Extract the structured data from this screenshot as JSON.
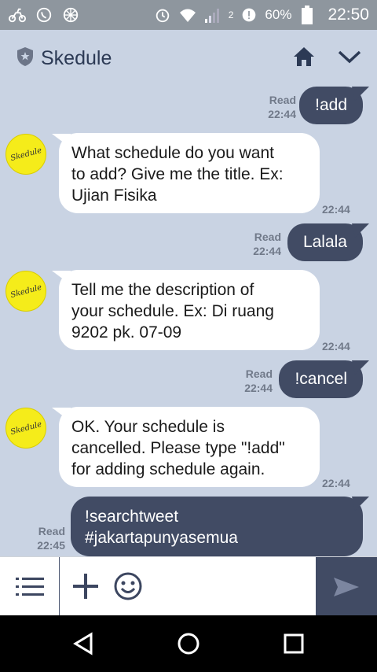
{
  "status_bar": {
    "battery": "60%",
    "time": "22:50",
    "network_label": "2"
  },
  "header": {
    "title": "Skedule"
  },
  "avatar_text": "Skedule",
  "messages": [
    {
      "dir": "out",
      "text": "!add",
      "read": "Read",
      "time": "22:44"
    },
    {
      "dir": "in",
      "lines": [
        "What schedule do you want",
        "to add? Give me the title. Ex:",
        "Ujian Fisika"
      ],
      "time": "22:44"
    },
    {
      "dir": "out",
      "text": "Lalala",
      "read": "Read",
      "time": "22:44"
    },
    {
      "dir": "in",
      "lines": [
        "Tell me the description of",
        "your schedule. Ex: Di ruang",
        "9202 pk. 07-09"
      ],
      "time": "22:44"
    },
    {
      "dir": "out",
      "text": "!cancel",
      "read": "Read",
      "time": "22:44"
    },
    {
      "dir": "in",
      "lines": [
        "OK. Your schedule is",
        "cancelled. Please type \"!add\"",
        "for adding schedule again."
      ],
      "time": "22:44"
    },
    {
      "dir": "out",
      "lines": [
        "!searchtweet",
        "#jakartapunyasemua"
      ],
      "read": "Read",
      "time": "22:45"
    }
  ],
  "icons": {
    "status_left": [
      "bike-icon",
      "whatsapp-icon",
      "globe-icon"
    ],
    "status_right": [
      "alarm-icon",
      "wifi-icon",
      "signal-icon",
      "data-icon",
      "battery-icon"
    ],
    "header": [
      "shield-icon",
      "home-icon",
      "chevron-down-icon"
    ],
    "input": [
      "menu-icon",
      "plus-icon",
      "emoji-icon",
      "send-icon"
    ],
    "nav": [
      "back-icon",
      "home-circle-icon",
      "recents-icon"
    ]
  },
  "colors": {
    "chat_bg": "#c9d3e3",
    "outgoing_bubble": "#414b64",
    "incoming_bubble": "#ffffff",
    "avatar": "#f5ec1a",
    "status_bar": "#8e969e"
  }
}
